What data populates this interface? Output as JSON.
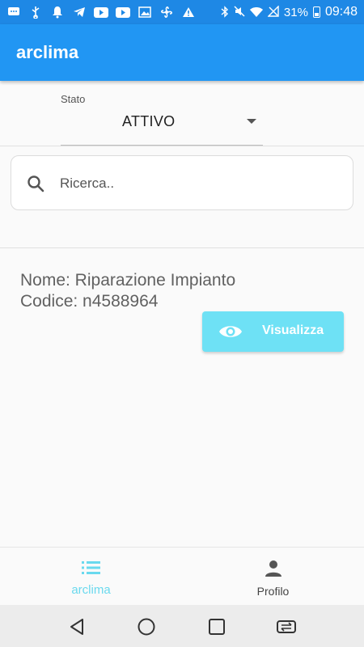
{
  "status_bar": {
    "battery_percent": "31%",
    "time": "09:48",
    "icons": [
      "chat-icon",
      "usb-icon",
      "bell-icon",
      "telegram-icon",
      "youtube-icon",
      "youtube-icon",
      "image-icon",
      "fan-icon",
      "warning-icon",
      "bluetooth-icon",
      "mute-icon",
      "wifi-icon",
      "no-signal-icon",
      "battery-icon"
    ]
  },
  "app_bar": {
    "title": "arclima"
  },
  "filter": {
    "label": "Stato",
    "value": "ATTIVO"
  },
  "search": {
    "placeholder": "Ricerca.."
  },
  "items": [
    {
      "name": "Nome: Riparazione Impianto",
      "code": "Codice: n4588964",
      "button_label": "Visualizza"
    }
  ],
  "bottom_nav": {
    "items": [
      {
        "label": "arclima",
        "icon": "list-icon",
        "active": true
      },
      {
        "label": "Profilo",
        "icon": "person-icon",
        "active": false
      }
    ]
  },
  "colors": {
    "status_bar": "#1e88e5",
    "app_bar": "#2196f3",
    "accent_button": "#6ee1f5",
    "active_nav": "#6ad9ee"
  }
}
